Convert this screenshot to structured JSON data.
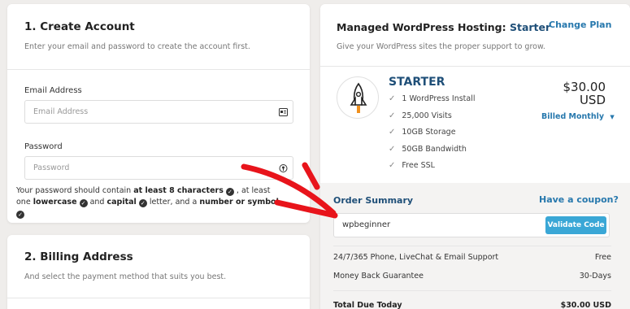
{
  "create_account": {
    "title": "1. Create Account",
    "subtitle": "Enter your email and password to create the account first.",
    "email_label": "Email Address",
    "email_placeholder": "Email Address",
    "password_label": "Password",
    "password_placeholder": "Password",
    "hint": {
      "p1": "Your password should contain ",
      "b1": "at least 8 characters",
      "p2": " , at least one ",
      "b2": "lowercase",
      "p3": " and ",
      "b3": "capital",
      "p4": " letter, and a ",
      "b4": "number or symbol."
    }
  },
  "billing": {
    "title": "2. Billing Address",
    "subtitle": "And select the payment method that suits you best."
  },
  "plan": {
    "header_prefix": "Managed WordPress Hosting: ",
    "header_plan": "Starter",
    "change_plan": "Change Plan",
    "subtitle": "Give your WordPress sites the proper support to grow.",
    "name": "STARTER",
    "price_amount": "$30.00",
    "price_currency": "USD",
    "billed": "Billed Monthly",
    "features": [
      "1 WordPress Install",
      "25,000 Visits",
      "10GB Storage",
      "50GB Bandwidth",
      "Free SSL"
    ]
  },
  "summary": {
    "title": "Order Summary",
    "have_coupon": "Have a coupon?",
    "coupon_value": "wpbeginner",
    "validate_label": "Validate Code",
    "rows": [
      {
        "label": "24/7/365 Phone, LiveChat & Email Support",
        "value": "Free"
      },
      {
        "label": "Money Back Guarantee",
        "value": "30-Days"
      }
    ],
    "total_label": "Total Due Today",
    "total_value": "$30.00 USD"
  },
  "colors": {
    "accent": "#2778ad",
    "plan_blue": "#1f4f78",
    "validate_bg": "#3aa7d6",
    "arrow_red": "#e8141b"
  }
}
